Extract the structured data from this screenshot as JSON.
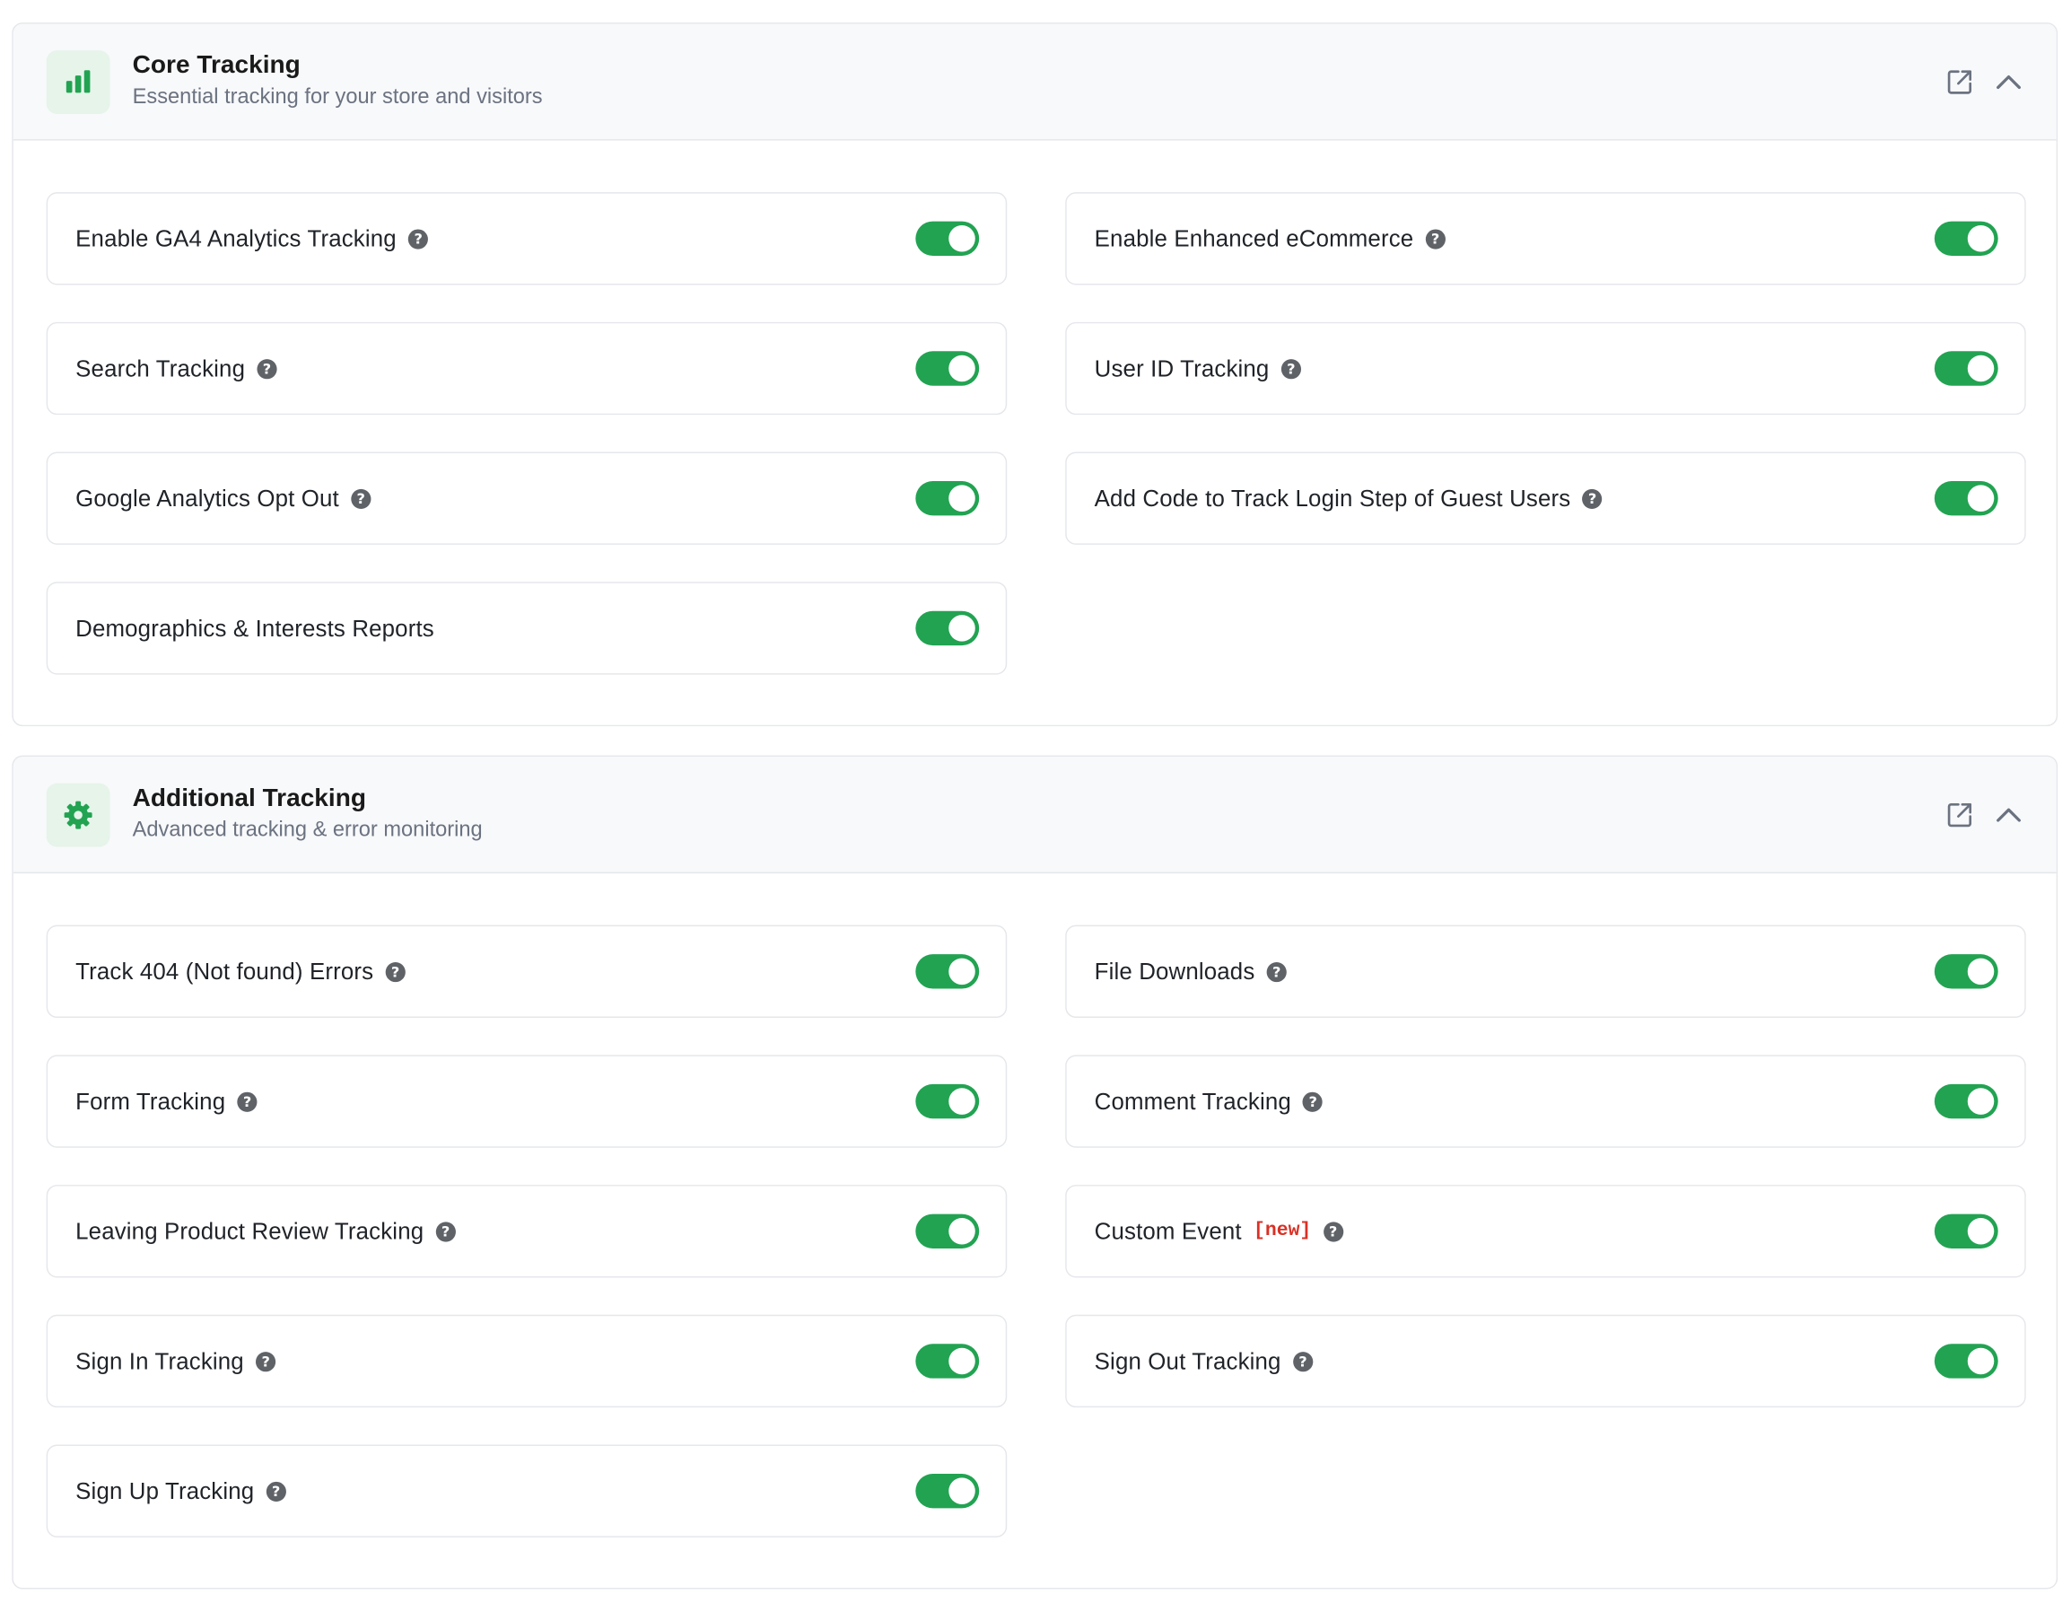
{
  "sections": [
    {
      "title": "Core Tracking",
      "subtitle": "Essential tracking for your store and visitors",
      "icon": "bar-chart-icon",
      "accent_color": "#22a352",
      "items": [
        {
          "label": "Enable GA4 Analytics Tracking",
          "help": true,
          "enabled": true
        },
        {
          "label": "Enable Enhanced eCommerce",
          "help": true,
          "enabled": true
        },
        {
          "label": "Search Tracking",
          "help": true,
          "enabled": true
        },
        {
          "label": "User ID Tracking",
          "help": true,
          "enabled": true
        },
        {
          "label": "Google Analytics Opt Out",
          "help": true,
          "enabled": true
        },
        {
          "label": "Add Code to Track Login Step of Guest Users",
          "help": true,
          "enabled": true
        },
        {
          "label": "Demographics & Interests Reports",
          "help": false,
          "enabled": true
        }
      ]
    },
    {
      "title": "Additional Tracking",
      "subtitle": "Advanced tracking & error monitoring",
      "icon": "gear-icon",
      "accent_color": "#22a352",
      "items": [
        {
          "label": "Track 404 (Not found) Errors",
          "help": true,
          "enabled": true
        },
        {
          "label": "File Downloads",
          "help": true,
          "enabled": true
        },
        {
          "label": "Form Tracking",
          "help": true,
          "enabled": true
        },
        {
          "label": "Comment Tracking",
          "help": true,
          "enabled": true
        },
        {
          "label": "Leaving Product Review Tracking",
          "help": true,
          "enabled": true
        },
        {
          "label": "Custom Event",
          "badge": "[new]",
          "help": true,
          "enabled": true
        },
        {
          "label": "Sign In Tracking",
          "help": true,
          "enabled": true
        },
        {
          "label": "Sign Out Tracking",
          "help": true,
          "enabled": true
        },
        {
          "label": "Sign Up Tracking",
          "help": true,
          "enabled": true
        }
      ]
    }
  ],
  "help_glyph": "?",
  "colors": {
    "toggle_on": "#22a352",
    "badge_new": "#d93025",
    "icon_bg": "#e6f4ea"
  }
}
